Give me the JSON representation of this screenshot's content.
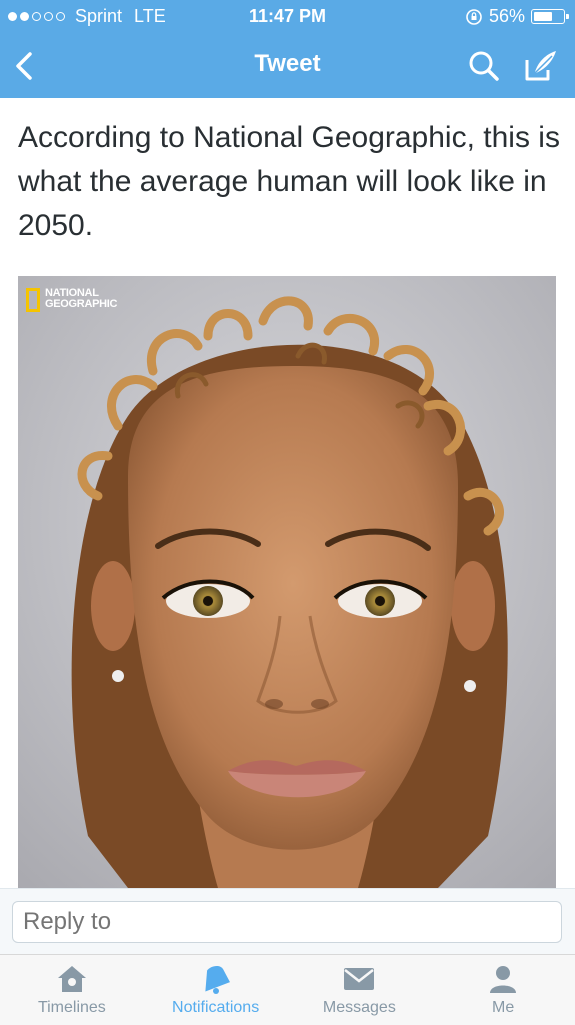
{
  "status_bar": {
    "signal_filled": 2,
    "signal_total": 5,
    "carrier": "Sprint",
    "network": "LTE",
    "time": "11:47 PM",
    "battery": "56%",
    "battery_level": 0.56
  },
  "nav": {
    "title": "Tweet"
  },
  "tweet": {
    "text": "According to National Geographic, this is what the average human will look like in 2050.",
    "image_logo": "NATIONAL GEOGRAPHIC"
  },
  "reply": {
    "placeholder": "Reply to"
  },
  "tabs": [
    {
      "label": "Timelines",
      "icon": "house-icon",
      "active": false
    },
    {
      "label": "Notifications",
      "icon": "bell-icon",
      "active": true
    },
    {
      "label": "Messages",
      "icon": "envelope-icon",
      "active": false
    },
    {
      "label": "Me",
      "icon": "person-icon",
      "active": false
    }
  ],
  "colors": {
    "brand_blue": "#5aaae6",
    "active_tab": "#55acee",
    "inactive_tab": "#8899a6"
  }
}
